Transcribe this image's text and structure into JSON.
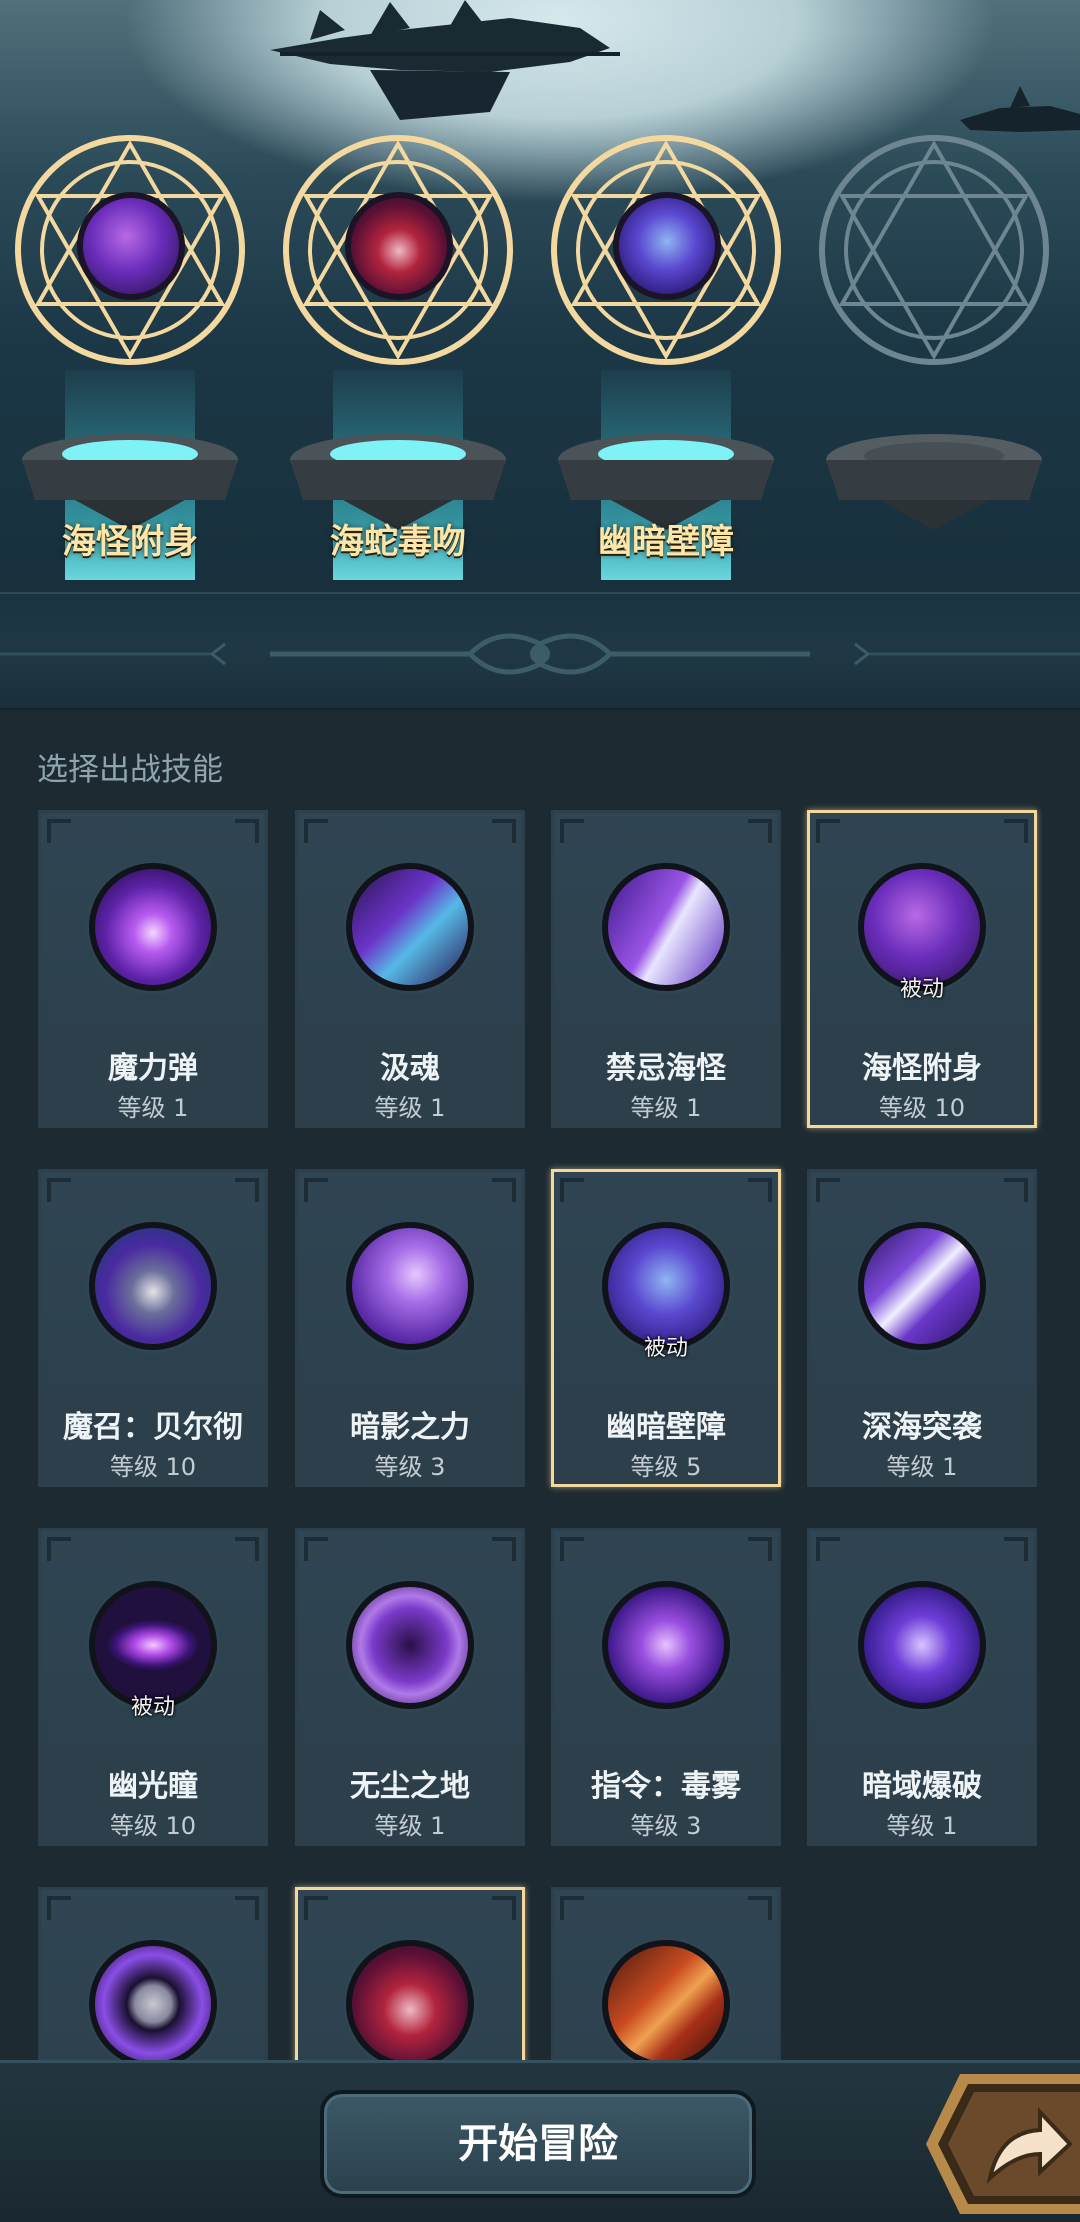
{
  "equipped_slots": [
    {
      "name": "海怪附身",
      "icon": "sea-monster-possession-icon",
      "filled": true
    },
    {
      "name": "海蛇毒吻",
      "icon": "sea-serpent-kiss-icon",
      "filled": true
    },
    {
      "name": "幽暗壁障",
      "icon": "dark-barrier-icon",
      "filled": true
    },
    {
      "name": "",
      "icon": "empty-slot-icon",
      "filled": false
    }
  ],
  "panel": {
    "title": "选择出战技能"
  },
  "skills": [
    {
      "name": "魔力弹",
      "level": "等级 1",
      "passive": "",
      "selected": false,
      "icon": "magic-bullet-icon"
    },
    {
      "name": "汲魂",
      "level": "等级 1",
      "passive": "",
      "selected": false,
      "icon": "soul-drain-icon"
    },
    {
      "name": "禁忌海怪",
      "level": "等级 1",
      "passive": "",
      "selected": false,
      "icon": "forbidden-sea-monster-icon"
    },
    {
      "name": "海怪附身",
      "level": "等级 10",
      "passive": "被动",
      "selected": true,
      "icon": "sea-monster-possession-icon"
    },
    {
      "name": "魔召：贝尔彻",
      "level": "等级 10",
      "passive": "",
      "selected": false,
      "icon": "summon-belche-icon"
    },
    {
      "name": "暗影之力",
      "level": "等级 3",
      "passive": "",
      "selected": false,
      "icon": "shadow-power-icon"
    },
    {
      "name": "幽暗壁障",
      "level": "等级 5",
      "passive": "被动",
      "selected": true,
      "icon": "dark-barrier-icon"
    },
    {
      "name": "深海突袭",
      "level": "等级 1",
      "passive": "",
      "selected": false,
      "icon": "deep-sea-raid-icon"
    },
    {
      "name": "幽光瞳",
      "level": "等级 10",
      "passive": "被动",
      "selected": false,
      "icon": "glow-eye-icon"
    },
    {
      "name": "无尘之地",
      "level": "等级 1",
      "passive": "",
      "selected": false,
      "icon": "dustless-land-icon"
    },
    {
      "name": "指令：毒雾",
      "level": "等级 3",
      "passive": "",
      "selected": false,
      "icon": "poison-fog-icon"
    },
    {
      "name": "暗域爆破",
      "level": "等级 1",
      "passive": "",
      "selected": false,
      "icon": "dark-blast-icon"
    },
    {
      "name": "",
      "level": "",
      "passive": "",
      "selected": false,
      "icon": "void-orb-icon"
    },
    {
      "name": "",
      "level": "",
      "passive": "",
      "selected": true,
      "icon": "sea-serpent-kiss-icon"
    },
    {
      "name": "",
      "level": "",
      "passive": "",
      "selected": false,
      "icon": "flame-sword-icon"
    }
  ],
  "bottom": {
    "start_label": "开始冒险",
    "share_icon": "share-arrow-icon"
  },
  "colors": {
    "selected_border": "#f6d79b",
    "slot_name": "#fde6a8",
    "card_bg": "#2c3f4b",
    "beam": "#5ce0ea"
  }
}
